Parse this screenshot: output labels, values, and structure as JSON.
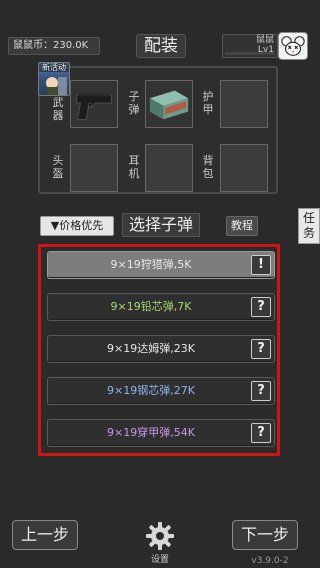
{
  "header": {
    "currency_text": "鼠鼠币：230.0K",
    "loadout_title": "配装",
    "profile_name": "鼠鼠",
    "profile_level": "Lv1"
  },
  "new_event_badge": "新活动",
  "equipment": {
    "weapon_label": "武器",
    "ammo_label": "子弹",
    "armor_label": "护甲",
    "helmet_label": "头盔",
    "earphone_label": "耳机",
    "backpack_label": "背包"
  },
  "filter": {
    "sort_label": "▼价格优先",
    "select_ammo_label": "选择子弹",
    "tutorial_label": "教程",
    "task_label": "任务"
  },
  "ammo_list": [
    {
      "name": "9×19狩猎弹,5K",
      "color": "#e8e8e8",
      "badge": "!",
      "selected": true
    },
    {
      "name": "9×19铅芯弹,7K",
      "color": "#a8d870",
      "badge": "?",
      "selected": false
    },
    {
      "name": "9×19达姆弹,23K",
      "color": "#e8e8e8",
      "badge": "?",
      "selected": false
    },
    {
      "name": "9×19钢芯弹,27K",
      "color": "#8cb4e8",
      "badge": "?",
      "selected": false
    },
    {
      "name": "9×19穿甲弹,54K",
      "color": "#c49ae8",
      "badge": "?",
      "selected": false
    }
  ],
  "footer": {
    "prev_label": "上一步",
    "next_label": "下一步",
    "settings_label": "设置",
    "version": "v3.9.0-2"
  },
  "colors": {
    "highlight_frame": "#d01414",
    "background": "#2a2a2a"
  }
}
